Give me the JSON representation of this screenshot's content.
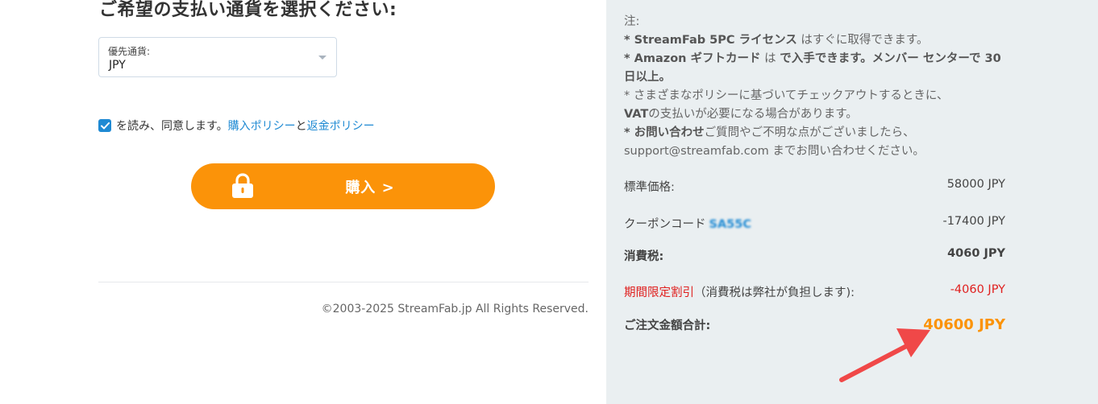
{
  "left": {
    "heading": "ご希望の支払い通貨を選択ください:",
    "currency": {
      "label": "優先通貨:",
      "value": "JPY"
    },
    "agree": {
      "text_before": "を読み、同意します。",
      "purchase_policy": "購入ポリシー",
      "and": "と",
      "refund_policy": "返金ポリシー"
    },
    "buy_button": "購入 >",
    "copyright": "©2003-2025 StreamFab.jp All Rights Reserved."
  },
  "notes": {
    "title": "注:",
    "line1_prefix": "* ",
    "line1_bold": "StreamFab 5PC ライセンス",
    "line1_rest": " はすぐに取得できます。",
    "line2_prefix": "* ",
    "line2_bold": "Amazon ギフトカード",
    "line2_mid": " は ",
    "line2_bold2": "で入手できます。メンバー センターで 30 日以上。",
    "line3_a": "* さまざまなポリシーに基づいてチェックアウトするときに、",
    "line3_bold": "VAT",
    "line3_rest": "の支払いが必要になる場合があります。",
    "line4_prefix": "* ",
    "line4_bold": "お問い合わせ",
    "line4_rest": "ご質問やご不明な点がございましたら、",
    "line5": "support@streamfab.com までお問い合わせください。"
  },
  "summary": {
    "standard_label": "標準価格:",
    "standard_value": "58000 JPY",
    "coupon_label": "クーポンコード",
    "coupon_code": "SA55C",
    "coupon_value": "-17400 JPY",
    "tax_label": "消費税:",
    "tax_value": "4060 JPY",
    "discount_label": "期間限定割引",
    "discount_note": "（消費税は弊社が負担します):",
    "discount_value": "-4060 JPY",
    "total_label": "ご注文金額合計:",
    "total_value": "40600 JPY"
  },
  "colors": {
    "accent_orange": "#fb9309",
    "link_blue": "#1f8ad3",
    "discount_red": "#e0201f",
    "arrow_red": "#f04848",
    "panel_bg": "#eaeff1"
  }
}
